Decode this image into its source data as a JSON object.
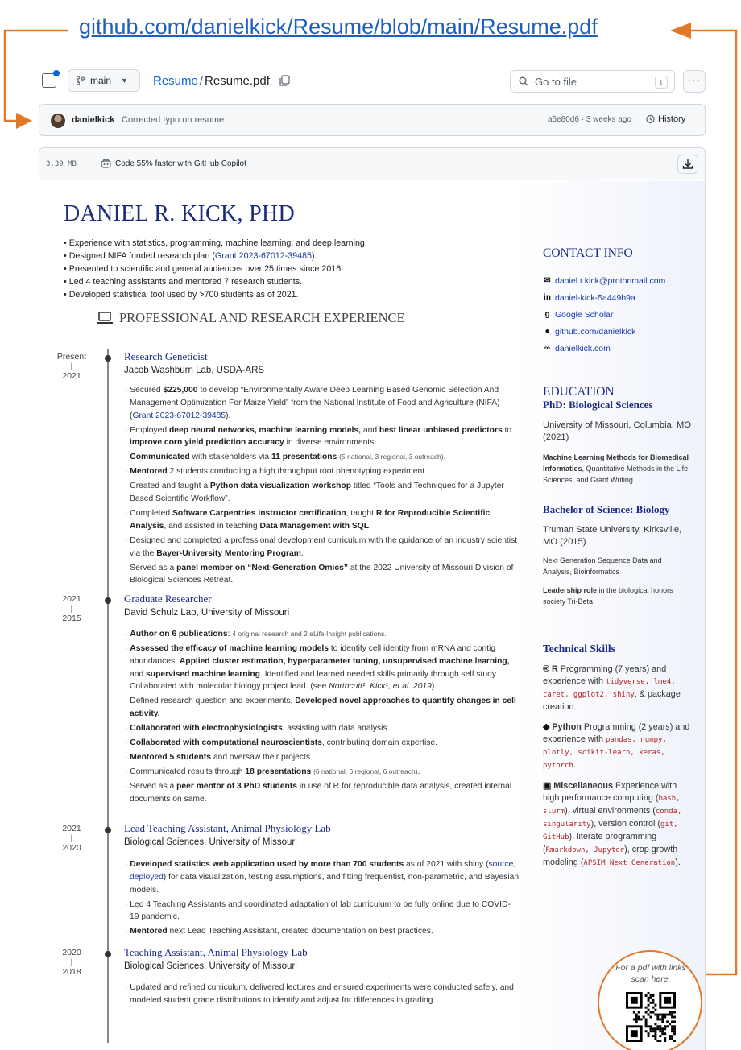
{
  "header_url": "github.com/danielkick/Resume/blob/main/Resume.pdf",
  "toolbar": {
    "branch": "main",
    "repo": "Resume",
    "separator": "/",
    "file": "Resume.pdf",
    "goto_placeholder": "Go to file",
    "goto_kbd": "t",
    "more": "···"
  },
  "commit": {
    "author": "danielkick",
    "message": "Corrected typo on resume",
    "meta": "a6e80d6 · 3 weeks ago",
    "history": "History"
  },
  "viewer": {
    "file_size": "3.39 MB",
    "copilot": "Code 55% faster with GitHub Copilot"
  },
  "resume": {
    "name": "DANIEL R. KICK, PHD",
    "summary": [
      {
        "pre": "Experience with statistics, programming, machine learning, and deep learning.",
        "link": "",
        "post": ""
      },
      {
        "pre": "Designed NIFA funded research plan (",
        "link": "Grant 2023-67012-39485",
        "post": ")."
      },
      {
        "pre": "Presented to scientific and general audiences over 25 times since 2016.",
        "link": "",
        "post": ""
      },
      {
        "pre": "Led 4 teaching assistants and mentored 7 research students.",
        "link": "",
        "post": ""
      },
      {
        "pre": "Developed statistical tool used by >700 students as of 2021.",
        "link": "",
        "post": ""
      }
    ],
    "experience_heading": "PROFESSIONAL AND RESEARCH EXPERIENCE",
    "jobs": [
      {
        "date_from": "Present",
        "date_to": "2021",
        "title": "Research Geneticist",
        "org": "Jacob Washburn Lab, USDA-ARS",
        "bullets": [
          "Secured <strong>$225,000</strong> to develop “Environmentally Aware Deep Learning Based Genomic Selection And Management Optimization For Maize Yield” from the National Institute of Food and Agriculture (NIFA) (<span class='blue'>Grant 2023-67012-39485</span>).",
          "Employed <strong>deep neural networks, machine learning models,</strong> and <strong>best linear unbiased predictors</strong> to <strong>improve corn yield prediction accuracy</strong> in diverse environments.",
          "<strong>Communicated</strong> with stakeholders via <strong>11 presentations</strong> <span class='small'>(5 national, 3 regional, 3 outreach)</span>.",
          "<strong>Mentored</strong> 2 students conducting a high throughput root phenotyping experiment.",
          "Created and taught a <strong>Python data visualization workshop</strong> titled “Tools and Techniques for a Jupyter Based Scientific Workflow”.",
          "Completed <strong>Software Carpentries instructor certification</strong>, taught <strong>R for Reproducible Scientific Analysis</strong>, and assisted in teaching <strong>Data Management with SQL</strong>.",
          "Designed and completed a professional development curriculum with the guidance of an industry scientist via the <strong>Bayer-University Mentoring Program</strong>.",
          "Served as a <strong>panel member on “Next-Generation Omics”</strong> at the 2022 University of Missouri Division of Biological Sciences Retreat."
        ]
      },
      {
        "date_from": "2021",
        "date_to": "2015",
        "title": "Graduate Researcher",
        "org": "David Schulz Lab, University of Missouri",
        "bullets": [
          "<strong>Author on 6 publications</strong>: <span class='small'>4 original research and 2 eLife Insight publications.</span>",
          "<strong>Assessed the efficacy of machine learning models</strong> to identify cell identity from mRNA and contig abundances. <strong>Applied cluster estimation, hyperparameter tuning, unsupervised machine learning,</strong> and <strong>supervised machine learning</strong>. Identified and learned needed skills primarily through self study. Collaborated with molecular biology project lead. (see <em>Northcutt¹, Kick¹, et al. 2019</em>).",
          "Defined research question and experiments. <strong>Developed novel approaches to quantify changes in cell activity.</strong>",
          "<strong>Collaborated with electrophysiologists</strong>, assisting with data analysis.",
          "<strong>Collaborated with computational neuroscientists</strong>, contributing domain expertise.",
          "<strong>Mentored 5 students</strong> and oversaw their projects.",
          "Communicated results through <strong>18 presentations</strong> <span class='small'>(6 national, 6 regional, 6 outreach)</span>.",
          "Served as a <strong>peer mentor of 3 PhD students</strong> in use of R for reproducible data analysis, created internal documents on same."
        ]
      },
      {
        "date_from": "2021",
        "date_to": "2020",
        "title": "Lead Teaching Assistant, Animal Physiology Lab",
        "org": "Biological Sciences, University of Missouri",
        "bullets": [
          "<strong>Developed statistics web application used by more than 700 students</strong> as of 2021 with shiny (<span class='blue'>source</span>, <span class='blue'>deployed</span>) for data visualization, testing assumptions, and fitting frequentist, non-parametric, and Bayesian models.",
          "Led 4 Teaching Assistants and coordinated adaptation of lab curriculum to be fully online due to COVID-19 pandemic.",
          "<strong>Mentored</strong> next Lead Teaching Assistant, created documentation on best practices."
        ]
      },
      {
        "date_from": "2020",
        "date_to": "2018",
        "title": "Teaching Assistant, Animal Physiology Lab",
        "org": "Biological Sciences, University of Missouri",
        "bullets": [
          "Updated and refined curriculum, delivered lectures and ensured experiments were conducted safely, and modeled student grade distributions to identify and adjust for differences in grading."
        ]
      }
    ],
    "contact": {
      "heading": "CONTACT INFO",
      "items": [
        {
          "icon": "email-icon",
          "glyph": "✉",
          "text": "daniel.r.kick@protonmail.com"
        },
        {
          "icon": "linkedin-icon",
          "glyph": "in",
          "text": "daniel-kick-5a449b9a"
        },
        {
          "icon": "google-scholar-icon",
          "glyph": "g",
          "text": "Google Scholar"
        },
        {
          "icon": "github-icon",
          "glyph": "●",
          "text": "github.com/danielkick"
        },
        {
          "icon": "link-icon",
          "glyph": "∞",
          "text": "danielkick.com"
        }
      ]
    },
    "education": {
      "heading": "EDUCATION",
      "phd_title": "PhD: Biological Sciences",
      "phd_school": "University of Missouri, Columbia, MO (2021)",
      "phd_note": "<strong>Machine Learning Methods for Biomedical Informatics</strong>, Quantitative Methods in the Life Sciences, and Grant Writing",
      "bs_title": "Bachelor of Science: Biology",
      "bs_school": "Truman State University, Kirksville, MO (2015)",
      "bs_note1": "Next Generation Sequence Data and Analysis, Bioinformatics",
      "bs_note2": "<strong>Leadership role</strong> in the biological honors society Tri-Beta"
    },
    "skills": {
      "heading": "Technical Skills",
      "r": "<strong>R</strong> Programming (7 years) and experience with <span class='code-red'>tidyverse, lme4, caret, ggplot2, shiny</span>, &amp; package creation.",
      "python": "<strong>Python</strong> Programming (2 years) and experience with <span class='code-red'>pandas, numpy, plotly, scikit-learn, keras, pytorch</span>.",
      "misc": "<strong>Miscellaneous</strong> Experience with high performance computing (<span class='code-red'>bash, slurm</span>), virtual environments (<span class='code-red'>conda, singularity</span>), version control (<span class='code-red'>git, GitHub</span>), literate programming (<span class='code-red'>Rmarkdown, Jupyter</span>), crop growth modeling (<span class='code-red'>APSIM Next Generation</span>)."
    },
    "qr_caption": "For a pdf with links scan here."
  },
  "colors": {
    "annotation_orange": "#e07a2a",
    "link_blue": "#1f5fbf",
    "resume_navy": "#1a2a7a"
  }
}
